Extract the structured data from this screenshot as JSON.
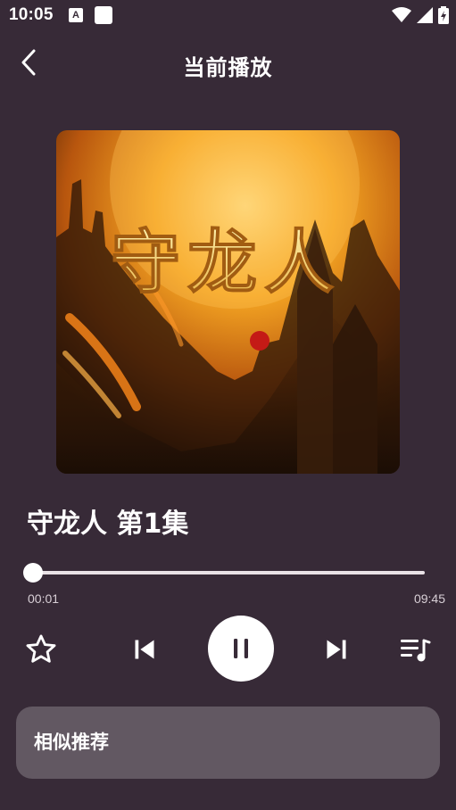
{
  "status_bar": {
    "time": "10:05",
    "icons": [
      "a-badge-icon",
      "square-notification-icon",
      "wifi-icon",
      "signal-icon",
      "battery-charging-icon"
    ]
  },
  "header": {
    "title": "当前播放",
    "back_icon": "chevron-left-icon"
  },
  "cover": {
    "title_text": "守龙人"
  },
  "track": {
    "title": "守龙人 第1集"
  },
  "progress": {
    "current": "00:01",
    "total": "09:45",
    "fraction": 0.002
  },
  "controls": {
    "favorite_icon": "star-outline-icon",
    "previous_icon": "skip-previous-icon",
    "play_pause_icon": "pause-icon",
    "next_icon": "skip-next-icon",
    "playlist_icon": "playlist-music-icon"
  },
  "similar": {
    "label": "相似推荐"
  },
  "colors": {
    "background": "#372a37",
    "card": "#625862",
    "accent": "#ffffff"
  }
}
